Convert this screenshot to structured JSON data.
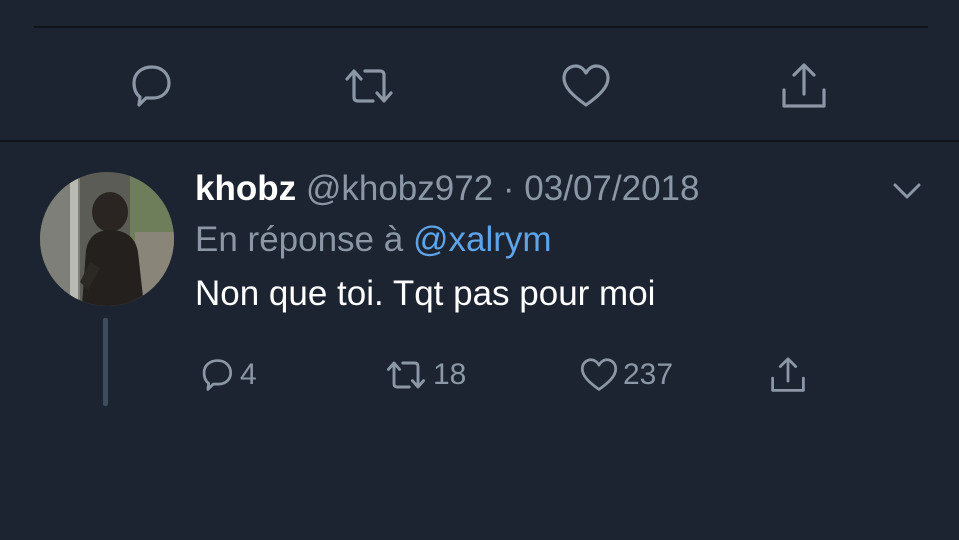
{
  "previous_tweet": {
    "actions": {
      "reply_icon": "speech-bubble-icon",
      "retweet_icon": "retweet-icon",
      "like_icon": "heart-icon",
      "share_icon": "share-upload-icon"
    }
  },
  "tweet": {
    "author": {
      "display_name": "khobz",
      "handle": "@khobz972",
      "separator": "·",
      "date": "03/07/2018"
    },
    "reply_prefix": "En réponse à",
    "reply_to": "@xalrym",
    "text": "Non que toi. Tqt pas pour moi",
    "counts": {
      "replies": "4",
      "retweets": "18",
      "likes": "237"
    }
  },
  "colors": {
    "background": "#1c2431",
    "text_primary": "#ffffff",
    "text_secondary": "#8b97a5",
    "link": "#5ea4e8",
    "icon": "#8b97a5"
  }
}
